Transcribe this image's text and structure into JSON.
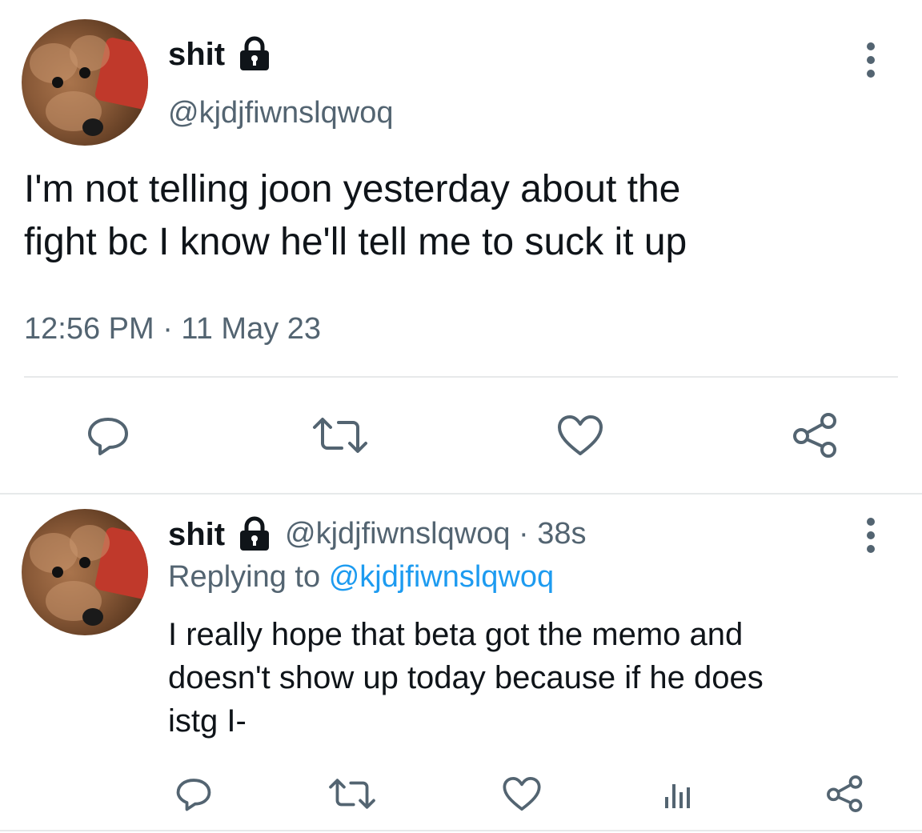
{
  "main_tweet": {
    "display_name": "shit",
    "handle": "@kjdjfiwnslqwoq",
    "text_line1": "I'm not telling joon yesterday about the",
    "text_line2": "fight bc I know he'll tell me to suck it up",
    "timestamp": "12:56 PM · 11 May 23",
    "actions": [
      "reply-icon",
      "retweet-icon",
      "like-icon",
      "share-icon"
    ]
  },
  "reply_tweet": {
    "display_name": "shit",
    "handle": "@kjdjfiwnslqwoq",
    "time": "· 38s",
    "replying_prefix": "Replying to",
    "replying_handle": "@kjdjfiwnslqwoq",
    "text_line1": "I really hope that beta got the memo and",
    "text_line2": "doesn't show up today because if he does",
    "text_line3": "istg I-",
    "actions": [
      "reply-icon",
      "retweet-icon",
      "like-icon",
      "analytics-icon",
      "share-icon"
    ]
  },
  "colors": {
    "text": "#0f1419",
    "muted": "#536471",
    "link": "#1d9bf0",
    "divider": "#e7e9ea"
  }
}
